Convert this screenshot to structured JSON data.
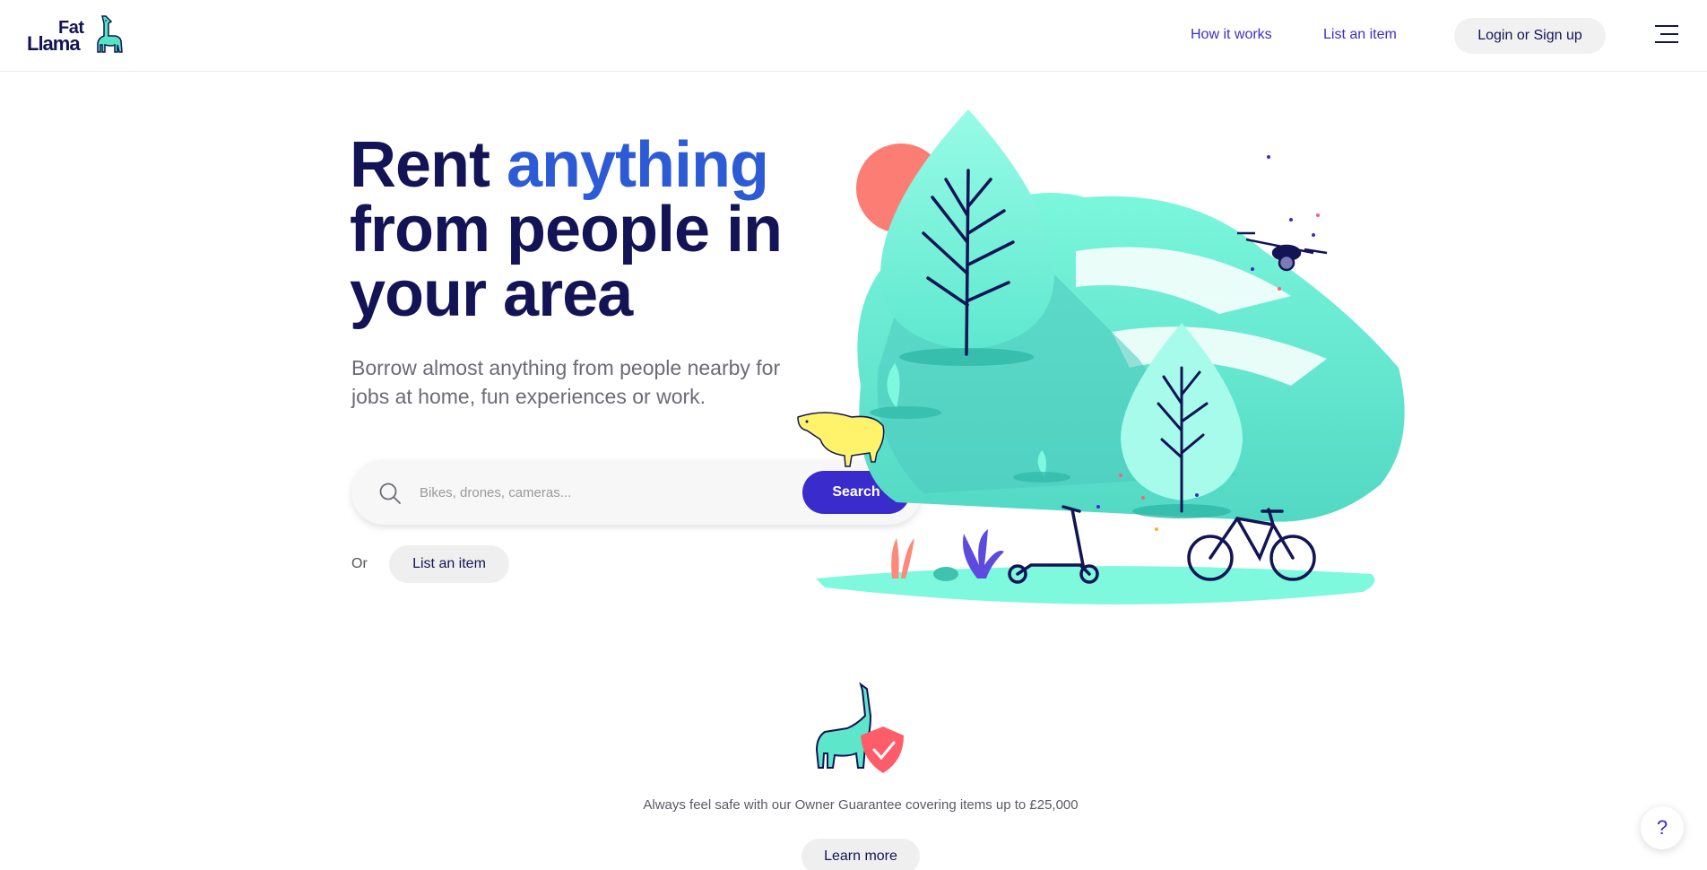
{
  "header": {
    "logo_top": "Fat",
    "logo_bottom": "Llama",
    "nav": {
      "how_it_works": "How it works",
      "list_an_item": "List an item"
    },
    "login_label": "Login or Sign up"
  },
  "hero": {
    "title_part1": "Rent ",
    "title_accent": "anything",
    "title_part2": "from people in your area",
    "subtitle": "Borrow almost anything from people nearby for jobs at home, fun experiences or work.",
    "search": {
      "placeholder": "Bikes, drones, cameras...",
      "button_label": "Search"
    },
    "or_label": "Or",
    "list_item_label": "List an item"
  },
  "guarantee": {
    "text": "Always feel safe with our Owner Guarantee covering items up to £25,000",
    "learn_more_label": "Learn more"
  },
  "help_label": "?",
  "colors": {
    "brand_navy": "#121455",
    "accent_blue": "#2d5bd6",
    "primary_button": "#3a2ccc",
    "mint": "#6ff5d8"
  },
  "icons": [
    "llama-logo-icon",
    "menu-icon",
    "search-icon",
    "llama-shield-icon",
    "help-icon"
  ]
}
